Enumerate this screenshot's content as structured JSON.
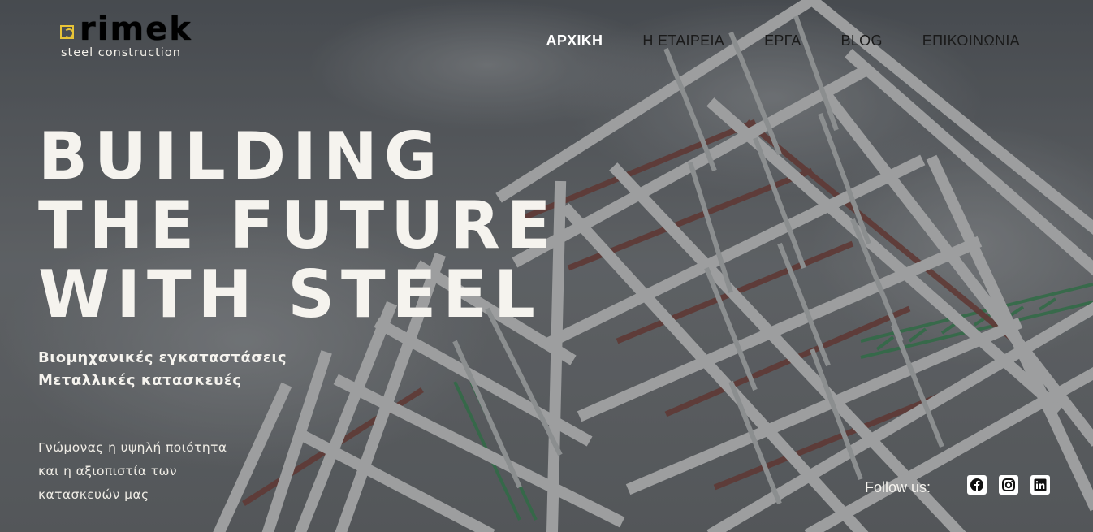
{
  "brand": {
    "name": "rimek",
    "tagline": "steel construction",
    "accent_color": "#e8c437"
  },
  "nav": {
    "items": [
      {
        "label": "ΑΡΧΙΚΗ",
        "active": true
      },
      {
        "label": "Η ΕΤΑΙΡΕΙΑ",
        "active": false
      },
      {
        "label": "ΕΡΓΑ",
        "active": false
      },
      {
        "label": "BLOG",
        "active": false
      },
      {
        "label": "ΕΠΙΚΟΙΝΩΝΙΑ",
        "active": false
      }
    ]
  },
  "hero": {
    "headline_lines": [
      "BUILDING",
      "THE FUTURE",
      "WITH STEEL"
    ],
    "subheading_lines": [
      "Βιομηχανικές εγκαταστάσεις",
      "Μεταλλικές κατασκευές"
    ],
    "description_lines": [
      "Γνώμονας η υψηλή ποιότητα",
      "και η αξιοπιστία των",
      "κατασκευών μας"
    ]
  },
  "social": {
    "label": "Follow us:",
    "icons": [
      "facebook-icon",
      "instagram-icon",
      "linkedin-icon"
    ]
  },
  "colors": {
    "text": "#f5f3ee",
    "nav_text": "#1a1a1a",
    "nav_active": "#ffffff"
  }
}
